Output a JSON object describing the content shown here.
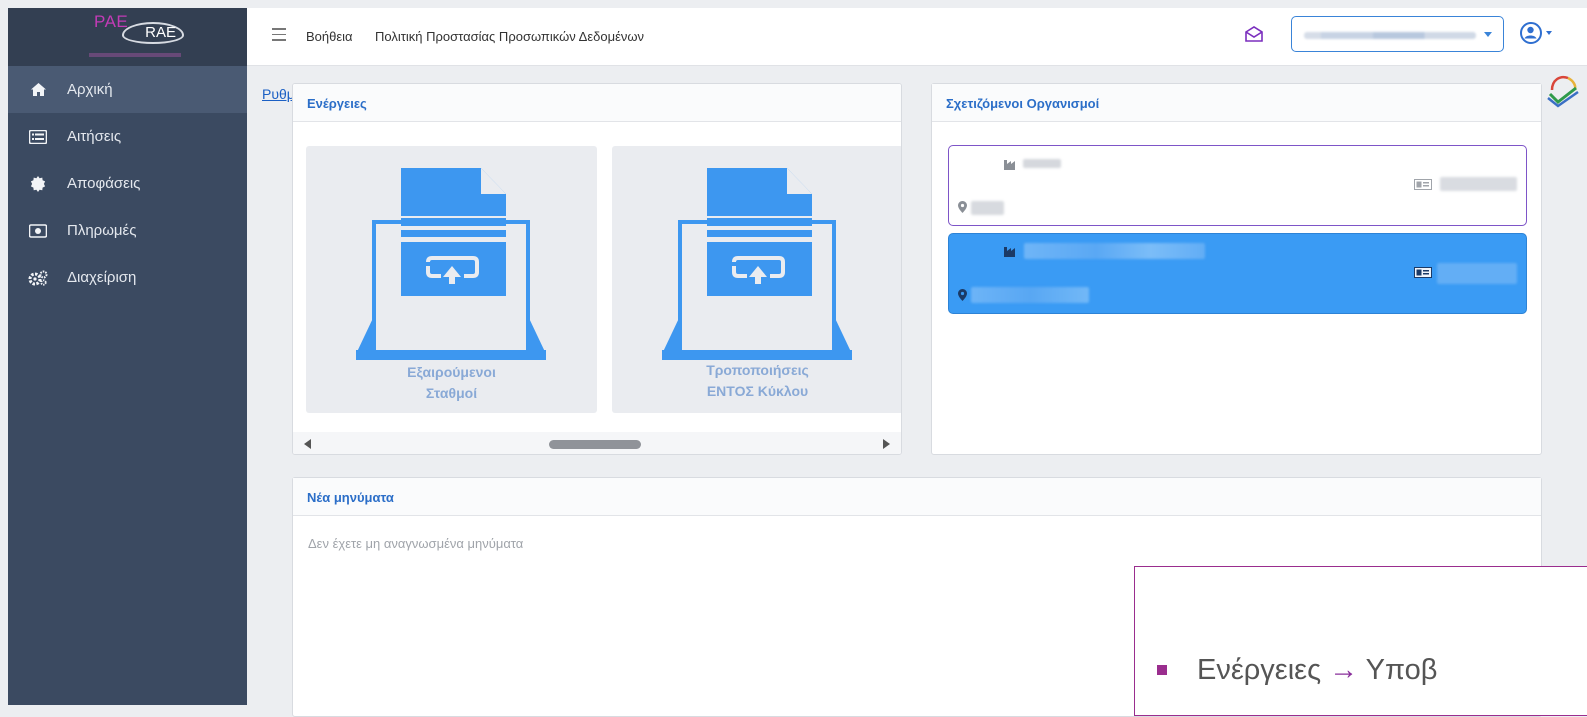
{
  "brand": {
    "pae": "PAE",
    "rae": "RAE"
  },
  "sidebar": {
    "items": [
      {
        "label": "Αρχική",
        "icon": "home-icon",
        "active": true
      },
      {
        "label": "Αιτήσεις",
        "icon": "list-icon",
        "active": false
      },
      {
        "label": "Αποφάσεις",
        "icon": "gear-badge-icon",
        "active": false
      },
      {
        "label": "Πληρωμές",
        "icon": "money-icon",
        "active": false
      },
      {
        "label": "Διαχείριση",
        "icon": "cogs-icon",
        "active": false
      }
    ]
  },
  "topbar": {
    "links": [
      "Βοήθεια",
      "Πολιτική Προστασίας Προσωπικών Δεδομένων"
    ],
    "org_select_value": ""
  },
  "settings_link": "Ρυθμ",
  "actions_panel": {
    "title": "Ενέργειες",
    "tiles": [
      {
        "label_line1": "Εξαιρούμενοι",
        "label_line2": "Σταθμοί"
      },
      {
        "label_line1": "Τροποποιήσεις",
        "label_line2": "ΕΝΤΟΣ Κύκλου"
      }
    ]
  },
  "orgs_panel": {
    "title": "Σχετιζόμενοι Οργανισμοί",
    "cards": [
      {
        "selected": false
      },
      {
        "selected": true
      }
    ]
  },
  "messages_panel": {
    "title": "Νέα μηνύματα",
    "empty_text": "Δεν έχετε μη αναγνωσμένα μηνύματα"
  },
  "overlay": {
    "text_before": "Ενέργειες",
    "arrow": "→",
    "text_after": "Υποβ"
  },
  "colors": {
    "sidebar": "#3b4a61",
    "accent_blue": "#2b6ec8",
    "selected_card": "#3a9bf4",
    "tile_icon": "#3d97f0",
    "overlay_border": "#9a2d8e"
  }
}
